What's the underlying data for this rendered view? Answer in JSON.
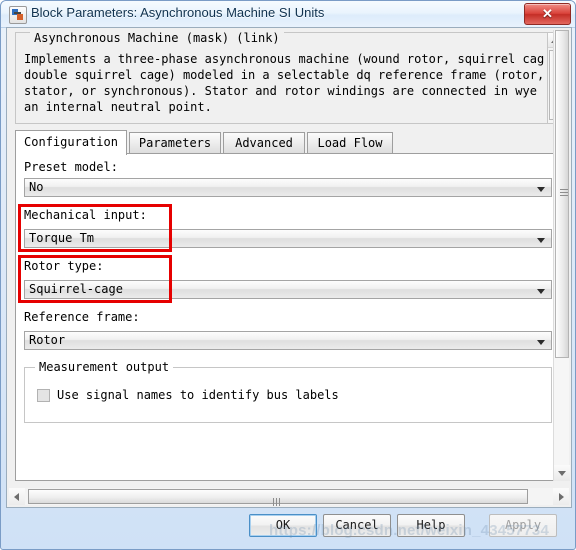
{
  "window": {
    "title": "Block Parameters: Asynchronous Machine SI Units",
    "icon": "simulink-block-icon",
    "close_label": "✕"
  },
  "description": {
    "legend": "Asynchronous Machine (mask) (link)",
    "body": "Implements a three-phase asynchronous machine (wound rotor, squirrel cage or\ndouble squirrel cage) modeled in a selectable dq reference frame (rotor,\nstator, or synchronous). Stator and rotor windings are connected in wye to\nan internal neutral point."
  },
  "tabs": [
    {
      "label": "Configuration",
      "active": true
    },
    {
      "label": "Parameters",
      "active": false
    },
    {
      "label": "Advanced",
      "active": false
    },
    {
      "label": "Load Flow",
      "active": false
    }
  ],
  "fields": [
    {
      "label": "Preset model:",
      "value": "No"
    },
    {
      "label": "Mechanical input:",
      "value": "Torque Tm"
    },
    {
      "label": "Rotor type:",
      "value": "Squirrel-cage"
    },
    {
      "label": "Reference frame:",
      "value": "Rotor"
    }
  ],
  "measurement": {
    "legend": "Measurement output",
    "checkbox_label": "Use signal names to identify bus labels",
    "checked": false
  },
  "annotations": {
    "color": "#e60000",
    "boxes": [
      {
        "target": "mechanical-input"
      },
      {
        "target": "rotor-type"
      }
    ]
  },
  "buttons": [
    {
      "label": "OK",
      "style": "default"
    },
    {
      "label": "Cancel",
      "style": "normal"
    },
    {
      "label": "Help",
      "style": "normal"
    },
    {
      "label": "Apply",
      "style": "disabled"
    }
  ],
  "watermark": "https://blog.csdn.net/weixin_43457734"
}
